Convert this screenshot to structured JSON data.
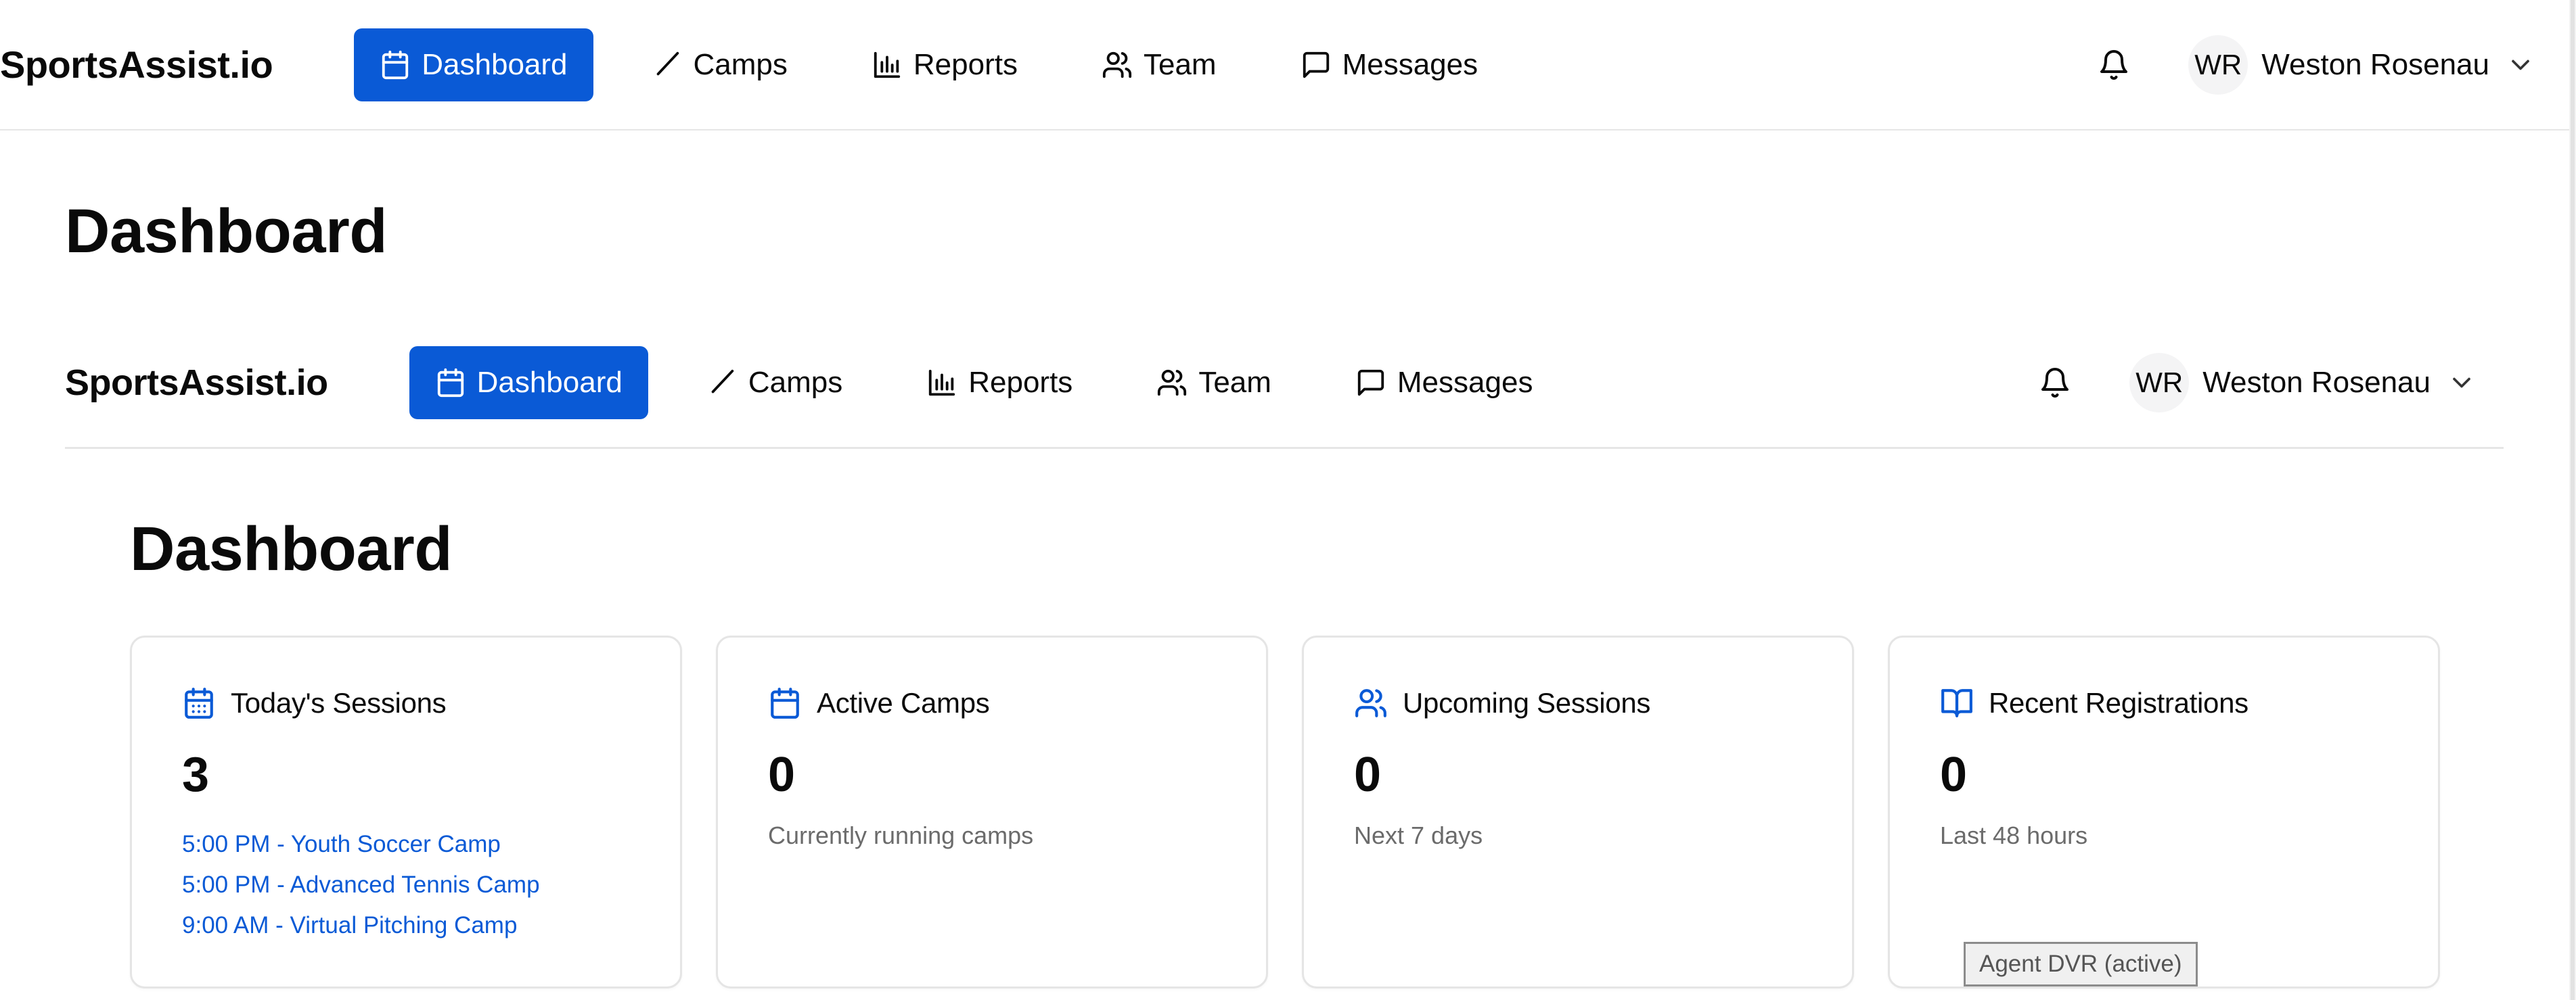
{
  "outer": {
    "brand": "SportsAssist.io",
    "nav": [
      {
        "label": "Dashboard",
        "icon": "calendar-icon",
        "active": true
      },
      {
        "label": "Camps",
        "icon": "slash-icon",
        "active": false
      },
      {
        "label": "Reports",
        "icon": "bar-chart-icon",
        "active": false
      },
      {
        "label": "Team",
        "icon": "users-icon",
        "active": false
      },
      {
        "label": "Messages",
        "icon": "message-square-icon",
        "active": false
      }
    ],
    "user": {
      "initials": "WR",
      "name": "Weston Rosenau"
    },
    "page_title": "Dashboard"
  },
  "inner": {
    "brand": "SportsAssist.io",
    "nav": [
      {
        "label": "Dashboard",
        "icon": "calendar-icon",
        "active": true
      },
      {
        "label": "Camps",
        "icon": "slash-icon",
        "active": false
      },
      {
        "label": "Reports",
        "icon": "bar-chart-icon",
        "active": false
      },
      {
        "label": "Team",
        "icon": "users-icon",
        "active": false
      },
      {
        "label": "Messages",
        "icon": "message-square-icon",
        "active": false
      }
    ],
    "user": {
      "initials": "WR",
      "name": "Weston Rosenau"
    },
    "page_title": "Dashboard"
  },
  "cards": [
    {
      "title": "Today's Sessions",
      "icon": "calendar-days-icon",
      "value": "3",
      "sessions": [
        "5:00 PM - Youth Soccer Camp",
        "5:00 PM - Advanced Tennis Camp",
        "9:00 AM - Virtual Pitching Camp"
      ]
    },
    {
      "title": "Active Camps",
      "icon": "calendar-icon",
      "value": "0",
      "subtitle": "Currently running camps"
    },
    {
      "title": "Upcoming Sessions",
      "icon": "users-icon",
      "value": "0",
      "subtitle": "Next 7 days"
    },
    {
      "title": "Recent Registrations",
      "icon": "book-open-icon",
      "value": "0",
      "subtitle": "Last 48 hours"
    }
  ],
  "tooltip": "Agent DVR (active)",
  "colors": {
    "accent": "#0a5ad6",
    "muted_text": "#6b6b6b",
    "border": "#e5e5e5"
  }
}
